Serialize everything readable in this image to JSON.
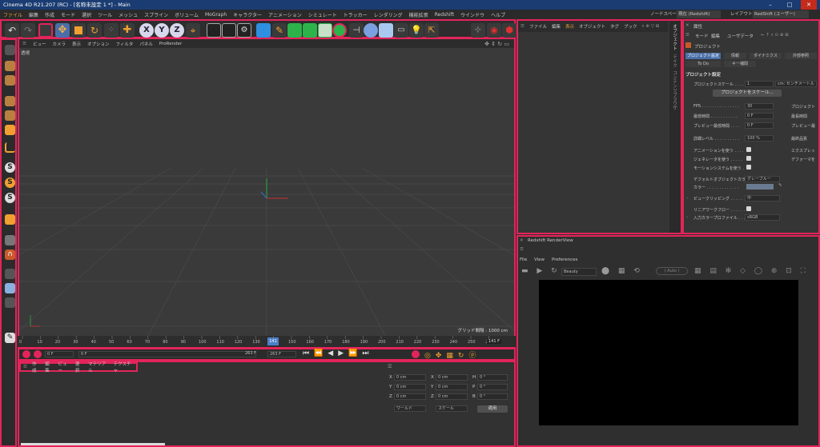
{
  "window": {
    "title": "Cinema 4D R21.207 (RC) - [名称未設定 1 *] - Main",
    "min": "–",
    "max": "□",
    "close": "✕"
  },
  "menu": {
    "items": [
      "ファイル",
      "編集",
      "作成",
      "モード",
      "選択",
      "ツール",
      "メッシュ",
      "スプライン",
      "ボリューム",
      "MoGraph",
      "キャラクター",
      "アニメーション",
      "シミュレート",
      "トラッカー",
      "レンダリング",
      "機能拡張",
      "Redshift",
      "ウインドウ",
      "ヘルプ"
    ],
    "nodespace_label": "ノードスペース:",
    "nodespace_value": "現在 (Redshift)",
    "layout_label": "レイアウト:",
    "layout_value": "RedShift (ユーザー)"
  },
  "toolbar": {
    "axis_x": "X",
    "axis_y": "Y",
    "axis_z": "Z"
  },
  "viewport": {
    "menu": [
      "ビュー",
      "カメラ",
      "表示",
      "オプション",
      "フィルタ",
      "パネル",
      "ProRender"
    ],
    "label": "透視",
    "grid_info": "グリッド間隔 : 1000 cm"
  },
  "timeline": {
    "ticks": [
      "0",
      "10",
      "20",
      "30",
      "40",
      "50",
      "60",
      "70",
      "80",
      "90",
      "100",
      "110",
      "120",
      "130",
      "140",
      "150",
      "160",
      "170",
      "180",
      "190",
      "200",
      "210",
      "220",
      "230",
      "240",
      "250",
      "260"
    ],
    "current_frame_badge": "141",
    "end_label": "141 F"
  },
  "transport": {
    "start_field": "0 F",
    "current_field": "0 F",
    "end_field": "263 F",
    "end_field2": "263 F"
  },
  "material_panel": {
    "menu": [
      "作成",
      "編集",
      "ビュー",
      "選択",
      "マテリアル",
      "テクスチャ"
    ],
    "coords": {
      "x": "X",
      "y": "Y",
      "z": "Z",
      "pos_val": "0 cm",
      "h": "H",
      "p": "P",
      "b": "B",
      "rot_val": "0 °",
      "world": "ワールド",
      "scale": "スケール",
      "apply": "適用"
    }
  },
  "object_panel": {
    "menu": [
      "ファイル",
      "編集",
      "表示",
      "オブジェクト",
      "タグ",
      "ブック"
    ],
    "side_tabs": [
      "オブジェクト",
      "テイク",
      "コンテンツブラウザ"
    ]
  },
  "attr_panel": {
    "title": "属性",
    "menu": [
      "モード",
      "編集",
      "ユーザデータ"
    ],
    "header": "プロジェクト",
    "tabs": [
      "プロジェクト設定",
      "情報",
      "ダイナミクス",
      "外部参照"
    ],
    "tabs2": [
      "To Do",
      "キー補間"
    ],
    "section": "プロジェクト設定",
    "scale_label": "プロジェクトスケール . . . . .",
    "scale_value": "1",
    "scale_unit": "cm: センチメートル",
    "scale_button": "プロジェクトをスケール...",
    "fps_label": "FPS . . . . . . . . . . . . . . .",
    "fps_value": "30",
    "fps_right": "プロジェクト",
    "min_label": "最低時間 . . . . . . . . . . .",
    "min_value": "0 F",
    "min_right": "最長時間",
    "prev_label": "プレビュー最低時間 . . . .",
    "prev_value": "0 F",
    "prev_right": "プレビュー最",
    "lod_label": "詳細レベル . . . . . . . . . .",
    "lod_value": "100 %",
    "lod_right": "最終品質",
    "anim_label": "アニメーションを使う . . . .",
    "anim_right": "エクスプレッ",
    "gen_label": "ジェネレータを使う . . . . .",
    "gen_right": "デフォーマを",
    "motion_label": "モーションシステムを使う .",
    "defcolor_label": "デフォルトオブジェクトカラー",
    "defcolor_value": "グレーブルー",
    "color_label": "カラー . . . . . . . . . . . . .",
    "clip_label": "ビュークリッピング . . . . .",
    "clip_value": "中",
    "linear_label": "リニアワークフロー . . . . . .",
    "profile_label": "入力カラープロファイル . . .",
    "profile_value": "sRGB"
  },
  "renderview": {
    "title": "Redshift RenderView",
    "menu": [
      "File",
      "View",
      "Preferences"
    ],
    "aov": "Beauty",
    "auto": "( Auto )"
  },
  "colors": {
    "accent_red": "#e3245a",
    "title_blue": "#1a3c72",
    "menu_highlight": "#e8a33c",
    "axis_y_green": "#2ea84a",
    "axis_x_red": "#c43030",
    "axis_z_blue": "#3070c8"
  }
}
